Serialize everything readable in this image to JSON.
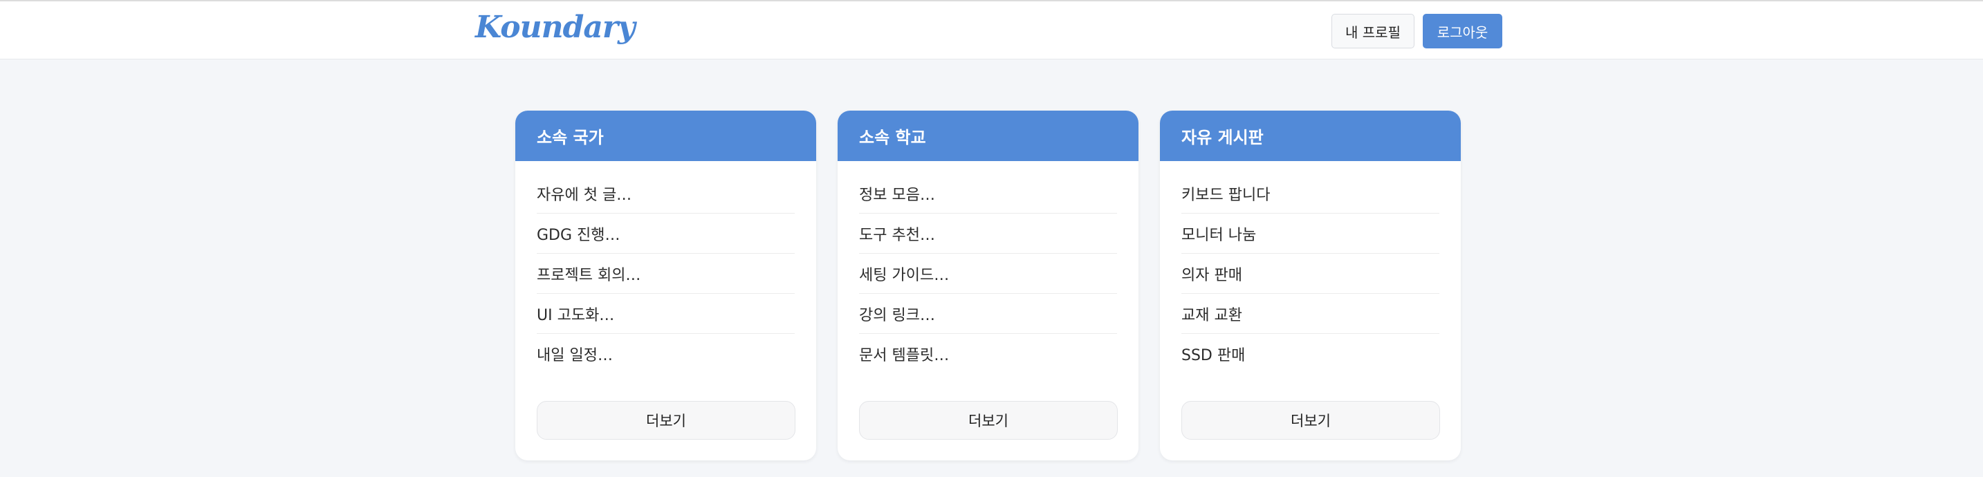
{
  "header": {
    "logo": "Koundary",
    "profile_label": "내 프로필",
    "logout_label": "로그아웃"
  },
  "cards": [
    {
      "title": "소속 국가",
      "items": [
        "자유에 첫 글…",
        "GDG 진행…",
        "프로젝트 회의…",
        "UI 고도화…",
        "내일 일정…"
      ],
      "more_label": "더보기"
    },
    {
      "title": "소속 학교",
      "items": [
        "정보 모음…",
        "도구 추천…",
        "세팅 가이드…",
        "강의 링크…",
        "문서 템플릿…"
      ],
      "more_label": "더보기"
    },
    {
      "title": "자유 게시판",
      "items": [
        "키보드 팝니다",
        "모니터 나눔",
        "의자 판매",
        "교재 교환",
        "SSD 판매"
      ],
      "more_label": "더보기"
    }
  ],
  "colors": {
    "accent": "#528ad8",
    "background": "#f4f6f9"
  }
}
